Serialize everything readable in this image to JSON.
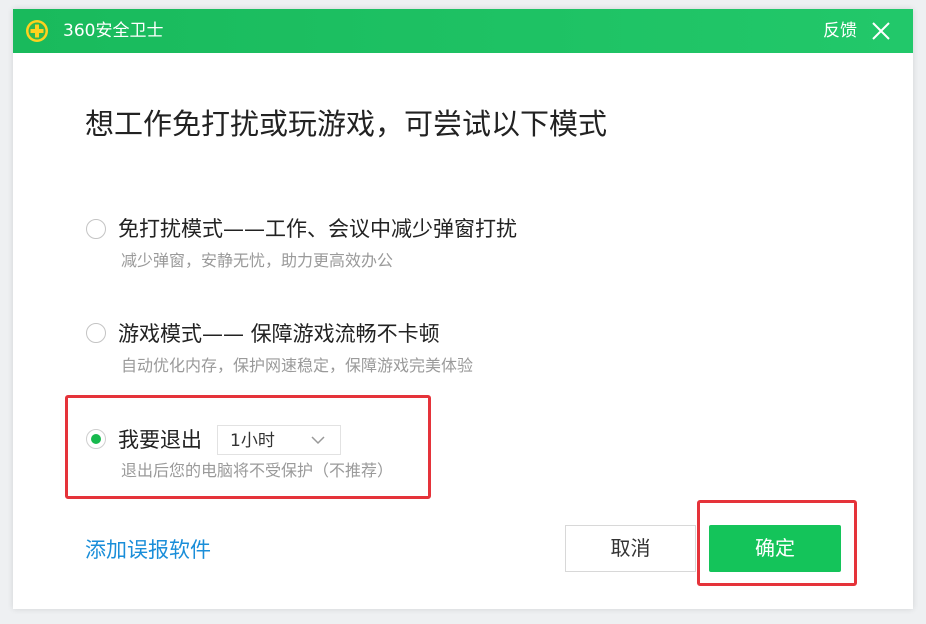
{
  "app": {
    "title": "360安全卫士",
    "feedback_label": "反馈"
  },
  "main": {
    "heading": "想工作免打扰或玩游戏，可尝试以下模式",
    "options": [
      {
        "title": "免打扰模式——工作、会议中减少弹窗打扰",
        "subtitle": "减少弹窗，安静无忧，助力更高效办公",
        "selected": false
      },
      {
        "title": "游戏模式—— 保障游戏流畅不卡顿",
        "subtitle": "自动优化内存，保护网速稳定，保障游戏完美体验",
        "selected": false
      },
      {
        "title": "我要退出",
        "subtitle": "退出后您的电脑将不受保护（不推荐）",
        "selected": true
      }
    ],
    "duration_select": {
      "value": "1小时"
    }
  },
  "footer": {
    "report_link": "添加误报软件",
    "cancel_label": "取消",
    "ok_label": "确定"
  },
  "colors": {
    "brand_green": "#19ba5c",
    "button_green": "#14c45a",
    "link_blue": "#1a8ed9",
    "highlight_red": "#e5333a"
  }
}
